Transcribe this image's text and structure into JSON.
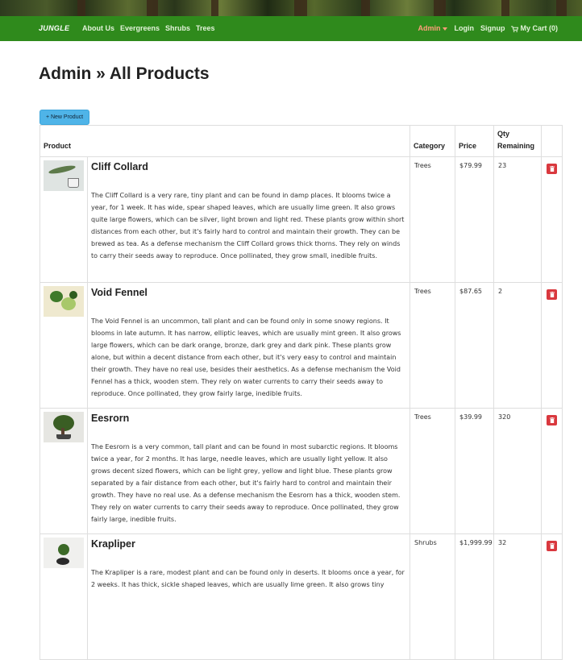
{
  "navbar": {
    "brand": "JUNGLE",
    "links": [
      "About Us",
      "Evergreens",
      "Shrubs",
      "Trees"
    ],
    "admin_label": "Admin",
    "login_label": "Login",
    "signup_label": "Signup",
    "cart_label": "My Cart (0)"
  },
  "page": {
    "title": "Admin » All Products",
    "new_product_label": "+ New Product"
  },
  "table": {
    "headers": {
      "product": "Product",
      "category": "Category",
      "price": "Price",
      "qty": "Qty Remaining"
    },
    "rows": [
      {
        "name": "Cliff Collard",
        "description": "The Cliff Collard is a very rare, tiny plant and can be found in damp places. It blooms twice a year, for 1 week. It has wide, spear shaped leaves, which are usually lime green. It also grows quite large flowers, which can be silver, light brown and light red. These plants grow within short distances from each other, but it's fairly hard to control and maintain their growth. They can be brewed as tea. As a defense mechanism the Cliff Collard grows thick thorns. They rely on winds to carry their seeds away to reproduce. Once pollinated, they grow small, inedible fruits.",
        "category": "Trees",
        "price": "$79.99",
        "qty": "23"
      },
      {
        "name": "Void Fennel",
        "description": "The Void Fennel is an uncommon, tall plant and can be found only in some snowy regions. It blooms in late autumn. It has narrow, elliptic leaves, which are usually mint green. It also grows large flowers, which can be dark orange, bronze, dark grey and dark pink. These plants grow alone, but within a decent distance from each other, but it's very easy to control and maintain their growth. They have no real use, besides their aesthetics. As a defense mechanism the Void Fennel has a thick, wooden stem. They rely on water currents to carry their seeds away to reproduce. Once pollinated, they grow fairly large, inedible fruits.",
        "category": "Trees",
        "price": "$87.65",
        "qty": "2"
      },
      {
        "name": "Eesrorn",
        "description": "The Eesrorn is a very common, tall plant and can be found in most subarctic regions. It blooms twice a year, for 2 months. It has large, needle leaves, which are usually light yellow. It also grows decent sized flowers, which can be light grey, yellow and light blue. These plants grow separated by a fair distance from each other, but it's fairly hard to control and maintain their growth. They have no real use. As a defense mechanism the Eesrorn has a thick, wooden stem. They rely on water currents to carry their seeds away to reproduce. Once pollinated, they grow fairly large, inedible fruits.",
        "category": "Trees",
        "price": "$39.99",
        "qty": "320"
      },
      {
        "name": "Krapliper",
        "description": "The Krapliper is a rare, modest plant and can be found only in deserts. It blooms once a year, for 2 weeks. It has thick, sickle shaped leaves, which are usually lime green. It also grows tiny",
        "category": "Shrubs",
        "price": "$1,999.99",
        "qty": "32"
      }
    ]
  },
  "colors": {
    "navbar": "#2f8a1c",
    "admin_link": "#ff9e7a",
    "new_button": "#4fb4e8",
    "delete_button": "#d9383e"
  },
  "icons": {
    "cart": "cart-icon",
    "delete": "trash-icon",
    "dropdown": "caret-down-icon"
  }
}
